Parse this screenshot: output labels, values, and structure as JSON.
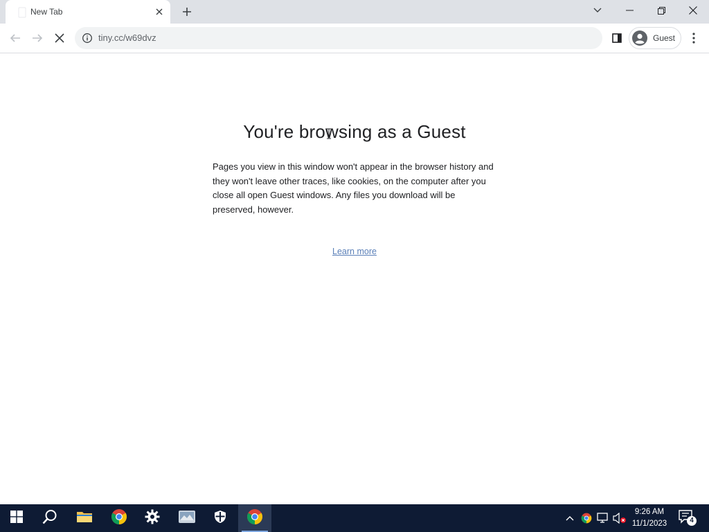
{
  "browser": {
    "tab": {
      "title": "New Tab"
    },
    "omnibox": {
      "url": "tiny.cc/w69dvz"
    },
    "profile": {
      "label": "Guest"
    }
  },
  "page": {
    "heading": "You're browsing as a Guest",
    "body": "Pages you view in this window won't appear in the browser history and they won't leave other traces, like cookies, on the computer after you close all open Guest windows. Any files you download will be preserved, however.",
    "learn_more": "Learn more"
  },
  "taskbar": {
    "apps": [
      "start-icon",
      "search-icon",
      "file-explorer-icon",
      "chrome-icon",
      "settings-icon",
      "photo-app-icon",
      "security-icon",
      "chrome-icon"
    ],
    "clock": {
      "time": "9:26 AM",
      "date": "11/1/2023"
    },
    "notifications": "4"
  },
  "colors": {
    "tabstrip": "#dee1e6",
    "link": "#5a7fb8",
    "taskbar": "#0e1b34"
  }
}
